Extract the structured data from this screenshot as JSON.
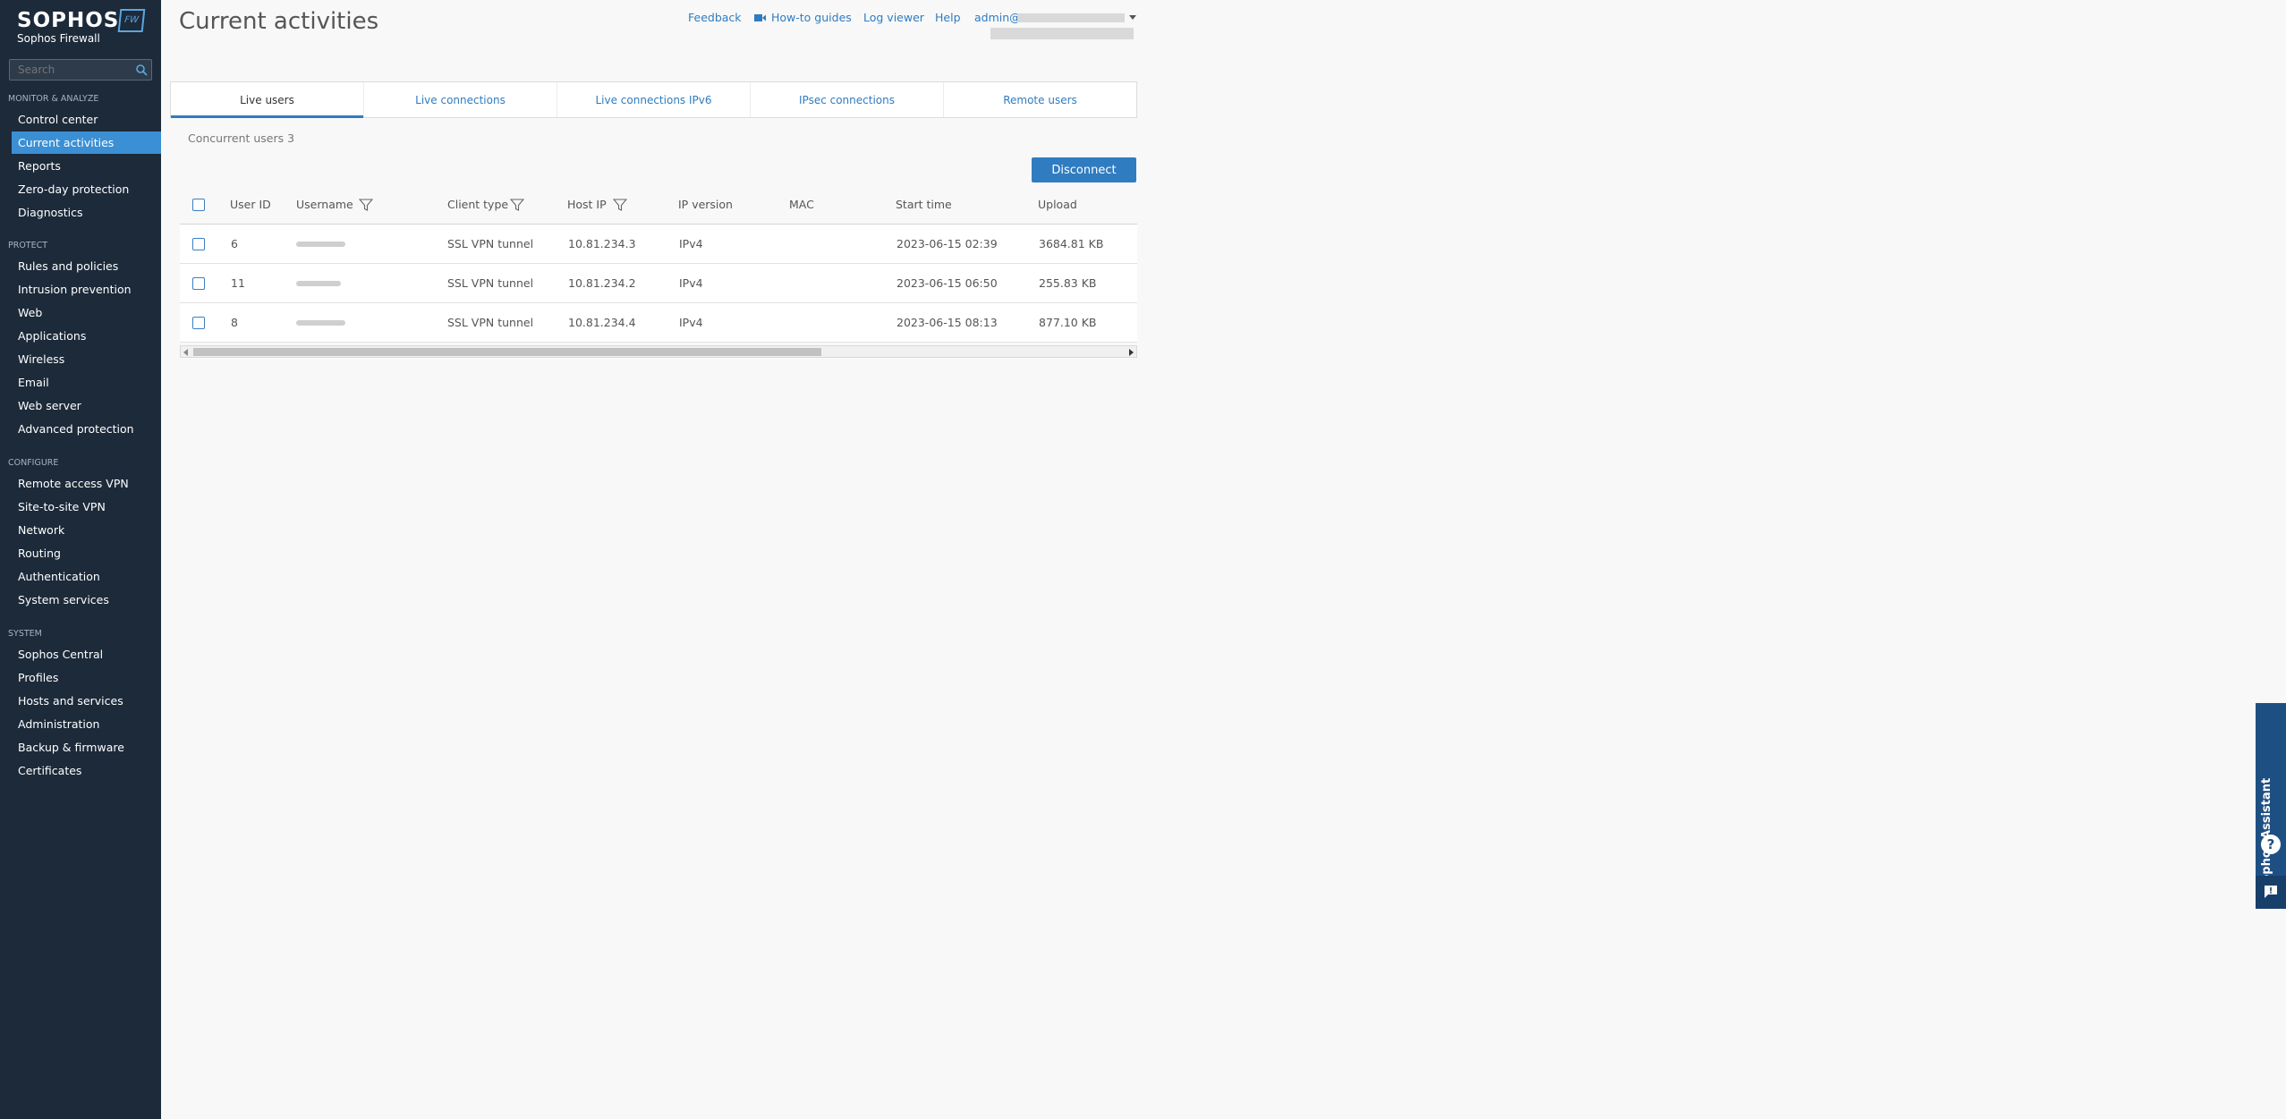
{
  "sidebar": {
    "logo": "SOPHOS",
    "logo_badge": "FW",
    "product": "Sophos Firewall",
    "search_placeholder": "Search",
    "sections": [
      {
        "heading": "MONITOR & ANALYZE",
        "items": [
          "Control center",
          "Current activities",
          "Reports",
          "Zero-day protection",
          "Diagnostics"
        ]
      },
      {
        "heading": "PROTECT",
        "items": [
          "Rules and policies",
          "Intrusion prevention",
          "Web",
          "Applications",
          "Wireless",
          "Email",
          "Web server",
          "Advanced protection"
        ]
      },
      {
        "heading": "CONFIGURE",
        "items": [
          "Remote access VPN",
          "Site-to-site VPN",
          "Network",
          "Routing",
          "Authentication",
          "System services"
        ]
      },
      {
        "heading": "SYSTEM",
        "items": [
          "Sophos Central",
          "Profiles",
          "Hosts and services",
          "Administration",
          "Backup & firmware",
          "Certificates"
        ]
      }
    ],
    "active_item": "Current activities"
  },
  "header": {
    "title": "Current activities",
    "links": {
      "feedback": "Feedback",
      "howto": "How-to guides",
      "logviewer": "Log viewer",
      "help": "Help",
      "admin": "admin@"
    }
  },
  "tabs": [
    "Live users",
    "Live connections",
    "Live connections IPv6",
    "IPsec connections",
    "Remote users"
  ],
  "active_tab": "Live users",
  "concurrent": "Concurrent users 3",
  "disconnect_label": "Disconnect",
  "table": {
    "columns": [
      "User ID",
      "Username",
      "Client type",
      "Host IP",
      "IP version",
      "MAC",
      "Start time",
      "Upload"
    ],
    "rows": [
      {
        "user_id": "6",
        "client_type": "SSL VPN tunnel",
        "host_ip": "10.81.234.3",
        "ip_version": "IPv4",
        "mac": "",
        "start_time": "2023-06-15 02:39",
        "upload": "3684.81 KB"
      },
      {
        "user_id": "11",
        "client_type": "SSL VPN tunnel",
        "host_ip": "10.81.234.2",
        "ip_version": "IPv4",
        "mac": "",
        "start_time": "2023-06-15 06:50",
        "upload": "255.83 KB"
      },
      {
        "user_id": "8",
        "client_type": "SSL VPN tunnel",
        "host_ip": "10.81.234.4",
        "ip_version": "IPv4",
        "mac": "",
        "start_time": "2023-06-15 08:13",
        "upload": "877.10 KB"
      }
    ]
  },
  "assistant": {
    "label": "Sophos Assistant"
  },
  "colors": {
    "sidebar_bg": "#1c2a3a",
    "accent": "#2f7cc0",
    "active_nav": "#3b8fd4",
    "assistant_bg": "#1e4f82"
  },
  "icons": [
    "search-icon",
    "video-icon",
    "caret-down-icon",
    "filter-icon",
    "question-icon",
    "feedback-icon",
    "arrow-left-icon",
    "arrow-right-icon"
  ]
}
